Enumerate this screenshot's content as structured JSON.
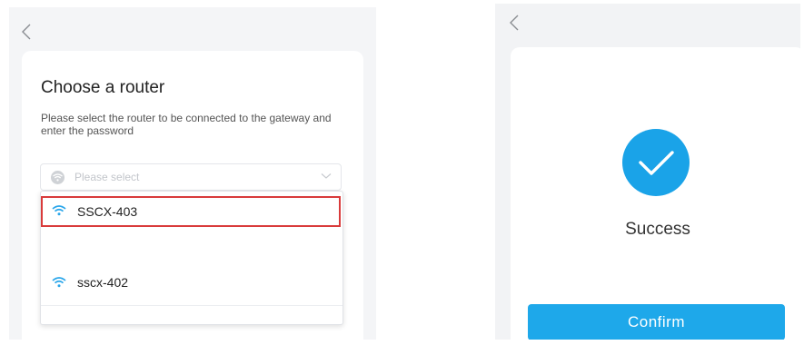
{
  "colors": {
    "accent": "#1ea8ea",
    "highlight_border": "#d93b3b",
    "panel_bg": "#f4f5f7"
  },
  "left_screen": {
    "back_icon": "chevron-left-icon",
    "title": "Choose a router",
    "subtitle": "Please select the router to be connected to the gateway and enter the password",
    "select": {
      "placeholder": "Please select",
      "icon": "wifi-icon",
      "chevron_icon": "chevron-down-icon"
    },
    "options": [
      {
        "label": "SSCX-403",
        "icon": "wifi-icon",
        "highlighted": true
      },
      {
        "label": "sscx-402",
        "icon": "wifi-icon",
        "highlighted": false
      }
    ]
  },
  "right_screen": {
    "back_icon": "chevron-left-icon",
    "status_icon": "checkmark-icon",
    "status_text": "Success",
    "confirm_label": "Confirm"
  }
}
